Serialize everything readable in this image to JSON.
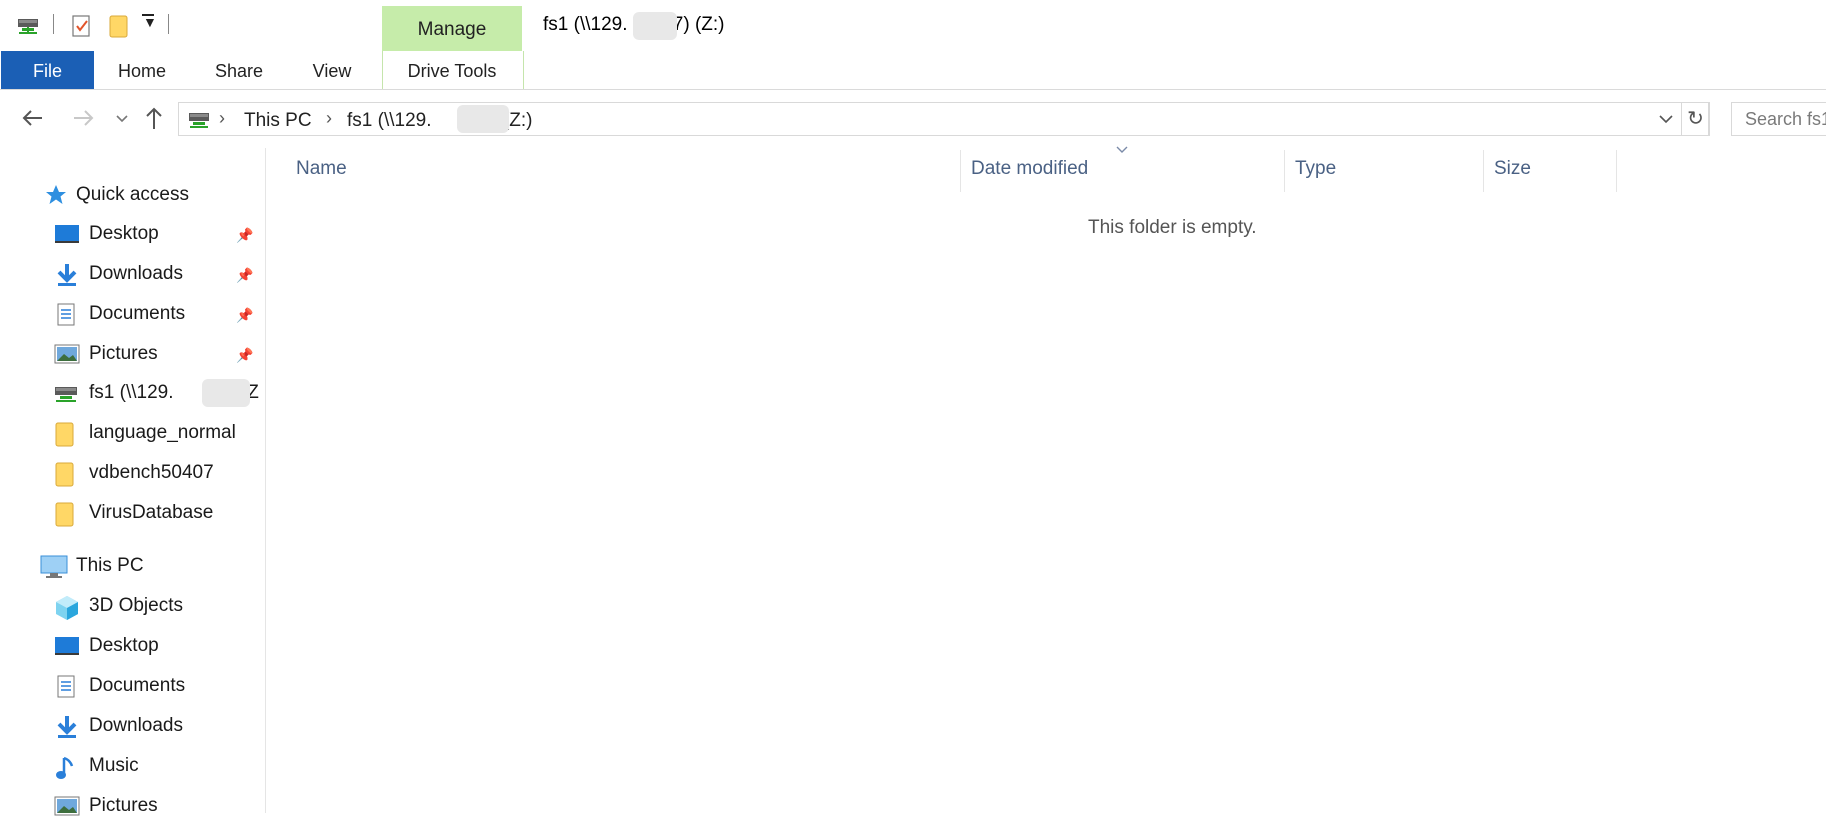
{
  "window": {
    "title_prefix": "fs1 (\\\\129.",
    "title_suffix": ".7) (Z:)"
  },
  "ribbon": {
    "manage_label": "Manage",
    "tabs": [
      {
        "label": "File"
      },
      {
        "label": "Home"
      },
      {
        "label": "Share"
      },
      {
        "label": "View"
      },
      {
        "label": "Drive Tools"
      }
    ]
  },
  "address": {
    "crumbs": [
      "This PC",
      "fs1 (\\\\129."
    ],
    "crumb_suffix": ".7) (Z:)"
  },
  "search": {
    "placeholder": "Search fs1"
  },
  "nav": {
    "quick_access": "Quick access",
    "quick_items": [
      {
        "label": "Desktop",
        "icon": "desktop-icon",
        "pinned": true
      },
      {
        "label": "Downloads",
        "icon": "downloads-icon",
        "pinned": true
      },
      {
        "label": "Documents",
        "icon": "documents-icon",
        "pinned": true
      },
      {
        "label": "Pictures",
        "icon": "pictures-icon",
        "pinned": true
      },
      {
        "label_prefix": "fs1 (\\\\129.",
        "label_suffix": ".7) (Z",
        "icon": "network-drive-icon"
      },
      {
        "label": "language_normal",
        "icon": "folder-icon"
      },
      {
        "label": "vdbench50407",
        "icon": "folder-icon"
      },
      {
        "label": "VirusDatabase",
        "icon": "folder-icon"
      }
    ],
    "this_pc": "This PC",
    "pc_items": [
      {
        "label": "3D Objects",
        "icon": "3d-objects-icon"
      },
      {
        "label": "Desktop",
        "icon": "desktop-icon"
      },
      {
        "label": "Documents",
        "icon": "documents-icon"
      },
      {
        "label": "Downloads",
        "icon": "downloads-icon"
      },
      {
        "label": "Music",
        "icon": "music-icon"
      },
      {
        "label": "Pictures",
        "icon": "pictures-icon"
      }
    ]
  },
  "content": {
    "columns": [
      "Name",
      "Date modified",
      "Type",
      "Size"
    ],
    "empty_message": "This folder is empty."
  }
}
